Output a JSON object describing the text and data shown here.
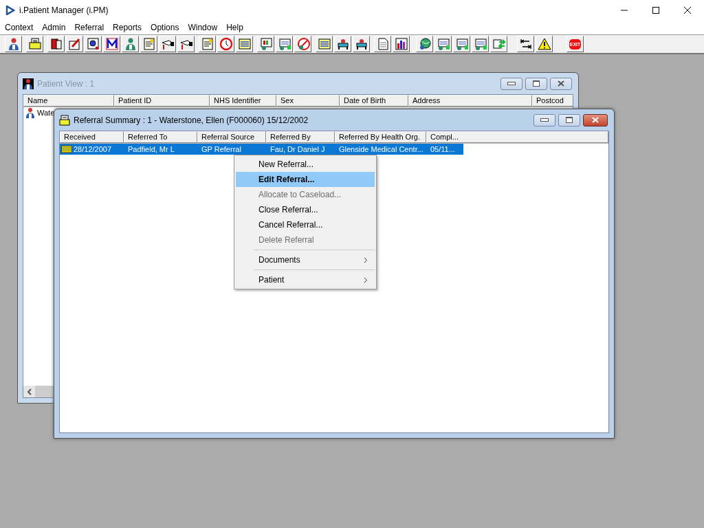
{
  "app": {
    "title": "i.Patient Manager (i.PM)"
  },
  "menu_bar": [
    "Context",
    "Admin",
    "Referral",
    "Reports",
    "Options",
    "Window",
    "Help"
  ],
  "toolbar": {
    "exit_label": "EXIT"
  },
  "patient_view": {
    "title": "Patient View : 1",
    "active": false,
    "columns": [
      "Name",
      "Patient ID",
      "NHS Identifier",
      "Sex",
      "Date of Birth",
      "Address",
      "Postcod"
    ],
    "rows": [
      {
        "name": "Wate"
      }
    ]
  },
  "referral_summary": {
    "title": "Referral Summary : 1 - Waterstone, Ellen (F000060) 15/12/2002",
    "active": true,
    "columns": [
      "Received",
      "Referred To",
      "Referral Source",
      "Referred By",
      "Referred By Health Org.",
      "Compl..."
    ],
    "rows": [
      {
        "selected": true,
        "cells": [
          "28/12/2007",
          "Padfield, Mr L",
          "GP Referral",
          "Fau, Dr Daniel J",
          "Glenside Medical Centr...",
          "05/11..."
        ]
      }
    ]
  },
  "context_menu": {
    "items": [
      {
        "kind": "command",
        "label": "New Referral...",
        "disabled": false,
        "selected": false,
        "default": false
      },
      {
        "kind": "command",
        "label": "Edit Referral...",
        "disabled": false,
        "selected": true,
        "default": true
      },
      {
        "kind": "command",
        "label": "Allocate to Caseload...",
        "disabled": true,
        "selected": false,
        "default": false
      },
      {
        "kind": "command",
        "label": "Close Referral...",
        "disabled": false,
        "selected": false,
        "default": false
      },
      {
        "kind": "command",
        "label": "Cancel Referral...",
        "disabled": false,
        "selected": false,
        "default": false
      },
      {
        "kind": "command",
        "label": "Delete Referral",
        "disabled": true,
        "selected": false,
        "default": false
      },
      {
        "kind": "separator"
      },
      {
        "kind": "submenu",
        "label": "Documents",
        "disabled": false,
        "selected": false,
        "default": false
      },
      {
        "kind": "separator"
      },
      {
        "kind": "submenu",
        "label": "Patient",
        "disabled": false,
        "selected": false,
        "default": false
      }
    ]
  }
}
